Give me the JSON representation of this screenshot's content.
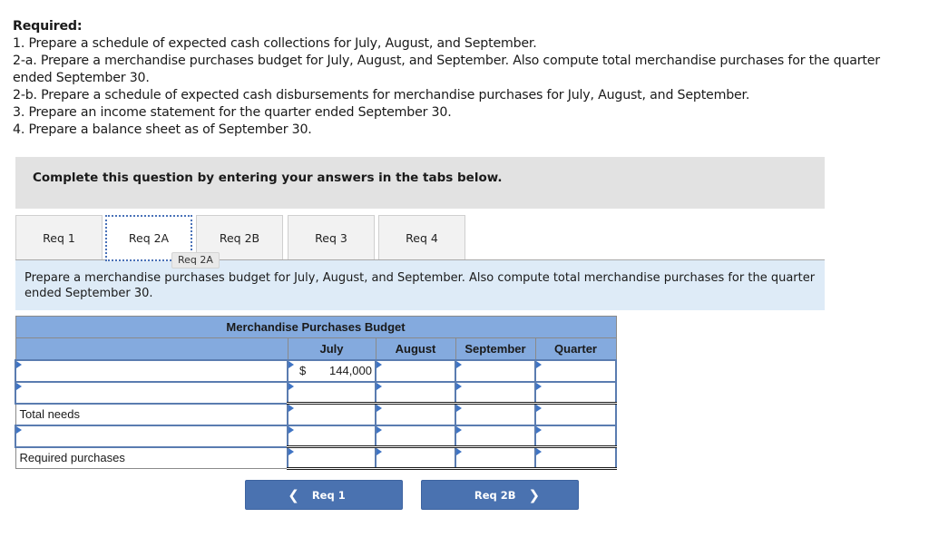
{
  "required": {
    "title": "Required:",
    "items": [
      "1. Prepare a schedule of expected cash collections for July, August, and September.",
      "2-a. Prepare a merchandise purchases budget for July, August, and September. Also compute total merchandise purchases for the quarter ended September 30.",
      "2-b. Prepare a schedule of expected cash disbursements for merchandise purchases for July, August, and September.",
      "3. Prepare an income statement for the quarter ended September 30.",
      "4. Prepare a balance sheet as of September 30."
    ]
  },
  "instructions": "Complete this question by entering your answers in the tabs below.",
  "tabs": [
    {
      "label": "Req 1",
      "active": false
    },
    {
      "label": "Req 2A",
      "active": true
    },
    {
      "label": "Req 2B",
      "active": false
    },
    {
      "label": "Req 3",
      "active": false
    },
    {
      "label": "Req 4",
      "active": false
    }
  ],
  "tooltip": "Req 2A",
  "prompt": "Prepare a merchandise purchases budget for July, August, and September. Also compute total merchandise purchases for the quarter ended September 30.",
  "budget": {
    "title": "Merchandise Purchases Budget",
    "columns": [
      "July",
      "August",
      "September",
      "Quarter"
    ],
    "rows": [
      {
        "label": "",
        "label_editable": true,
        "cells": [
          {
            "prefix": "$",
            "value": "144,000"
          },
          {
            "value": ""
          },
          {
            "value": ""
          },
          {
            "value": ""
          }
        ]
      },
      {
        "label": "",
        "label_editable": true,
        "cells": [
          {
            "value": ""
          },
          {
            "value": ""
          },
          {
            "value": ""
          },
          {
            "value": ""
          }
        ]
      },
      {
        "label": "Total needs",
        "label_editable": false,
        "cells": [
          {
            "value": ""
          },
          {
            "value": ""
          },
          {
            "value": ""
          },
          {
            "value": ""
          }
        ]
      },
      {
        "label": "",
        "label_editable": true,
        "cells": [
          {
            "value": ""
          },
          {
            "value": ""
          },
          {
            "value": ""
          },
          {
            "value": ""
          }
        ]
      },
      {
        "label": "Required purchases",
        "label_editable": false,
        "cells": [
          {
            "value": ""
          },
          {
            "value": ""
          },
          {
            "value": ""
          },
          {
            "value": ""
          }
        ]
      }
    ]
  },
  "nav": {
    "prev_label": "Req 1",
    "next_label": "Req 2B",
    "prev_icon": "chevron-left-icon",
    "next_icon": "chevron-right-icon"
  },
  "colors": {
    "header_blue": "#84aade",
    "button_blue": "#4a72b0",
    "prompt_bg": "#deebf7",
    "instructions_bg": "#e2e2e2"
  }
}
